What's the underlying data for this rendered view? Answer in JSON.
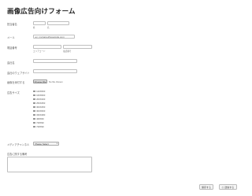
{
  "page": {
    "title": "画像広告向けフォーム"
  },
  "form": {
    "name": {
      "label": "担当者名",
      "first_sub": "姓",
      "last_sub": "名"
    },
    "email": {
      "label": "メール",
      "value": "ex: myname@example.com"
    },
    "phone": {
      "label": "電話番号",
      "area_sub": "エリアコード",
      "number_sub": "電話番号"
    },
    "company": {
      "label": "会社名"
    },
    "website": {
      "label": "会社のウェブサイト"
    },
    "attachment": {
      "label": "画像を添付する",
      "button": "Choose File",
      "status": "No file chosen"
    },
    "ad_size": {
      "label": "広告サイズ",
      "options": [
        "120X600",
        "160X600",
        "200X200",
        "250X250",
        "300X250",
        "300X600",
        "336X280",
        "468X60",
        "728X90",
        "728X90"
      ]
    },
    "media_channel": {
      "label": "メディアチャンネル",
      "select_value": "Please Select"
    },
    "remarks": {
      "label": "広告に関する備考"
    }
  },
  "footer": {
    "save_label": "保存する",
    "submit_label": "送信する",
    "submit_icon": "print-icon"
  }
}
